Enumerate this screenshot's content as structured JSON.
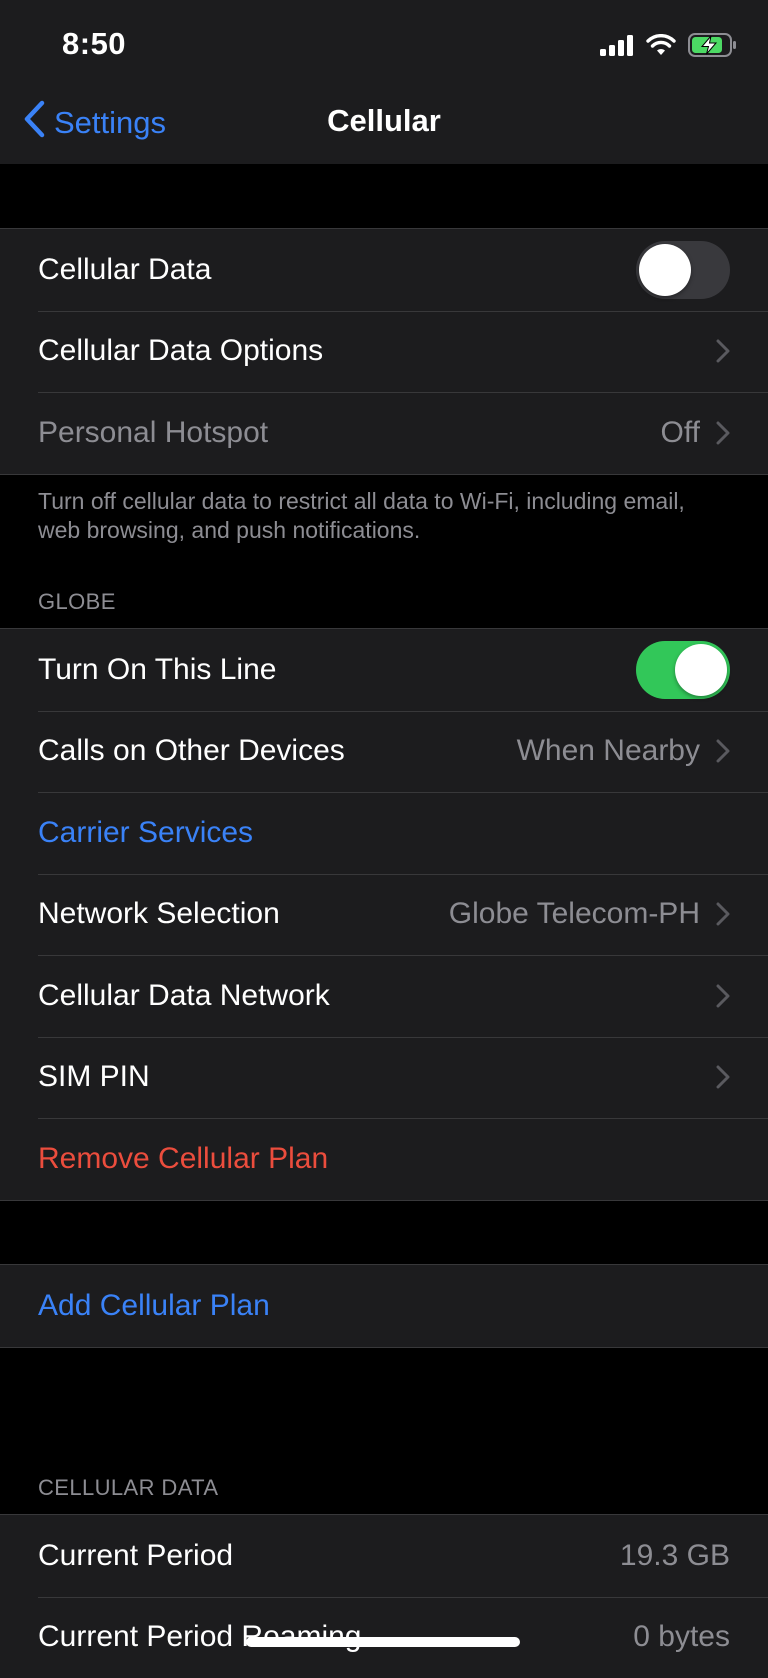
{
  "status_bar": {
    "time": "8:50",
    "icons": [
      "cellular-signal-icon",
      "wifi-icon",
      "battery-charging-icon"
    ],
    "battery_color": "#4cd964"
  },
  "nav": {
    "back_label": "Settings",
    "title": "Cellular",
    "back_icon": "chevron-left-icon",
    "accent_color": "#3a82f7"
  },
  "group1": {
    "cellular_data": {
      "label": "Cellular Data",
      "toggle": "off"
    },
    "cellular_data_options": {
      "label": "Cellular Data Options"
    },
    "personal_hotspot": {
      "label": "Personal Hotspot",
      "value": "Off"
    }
  },
  "group1_footer": "Turn off cellular data to restrict all data to Wi-Fi, including email, web browsing, and push notifications.",
  "globe_section": {
    "header": "GLOBE",
    "turn_on_line": {
      "label": "Turn On This Line",
      "toggle": "on"
    },
    "calls_other_devices": {
      "label": "Calls on Other Devices",
      "value": "When Nearby"
    },
    "carrier_services": {
      "label": "Carrier Services"
    },
    "network_selection": {
      "label": "Network Selection",
      "value": "Globe Telecom-PH"
    },
    "cellular_data_network": {
      "label": "Cellular Data Network"
    },
    "sim_pin": {
      "label": "SIM PIN"
    },
    "remove_plan": {
      "label": "Remove Cellular Plan"
    }
  },
  "add_plan": {
    "label": "Add Cellular Plan"
  },
  "cellular_data_section": {
    "header": "CELLULAR DATA",
    "current_period": {
      "label": "Current Period",
      "value": "19.3 GB"
    },
    "current_period_roaming": {
      "label": "Current Period Roaming",
      "value": "0 bytes"
    }
  },
  "colors": {
    "link": "#3a82f7",
    "danger": "#eb4d3d",
    "toggle_on": "#32c759",
    "secondary_text": "#8d8d93"
  }
}
